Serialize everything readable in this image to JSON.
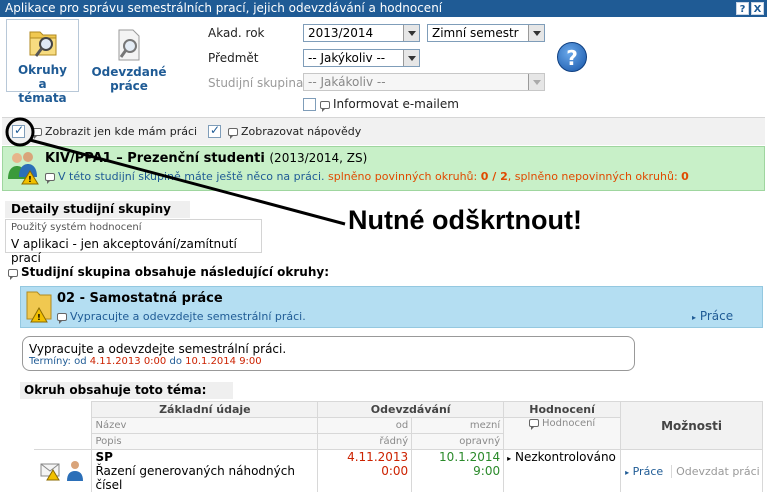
{
  "window": {
    "title": "Aplikace pro správu semestrálních prací, jejich odevzdávání a hodnocení",
    "help_button": "?",
    "close_button": "X"
  },
  "nav": {
    "topics": "Okruhy a témata",
    "submitted": "Odevzdané práce"
  },
  "filters": {
    "year_label": "Akad. rok",
    "year_value": "2013/2014",
    "semester_value": "Zimní semestr",
    "subject_label": "Předmět",
    "subject_value": "-- Jakýkoliv --",
    "group_label": "Studijní skupina",
    "group_value": "-- Jakákoliv --",
    "notify_label": "Informovat e-mailem",
    "show_only_mine_label": "Zobrazit jen kde mám práci",
    "show_hints_label": "Zobrazovat nápovědy",
    "help_icon": "?"
  },
  "group": {
    "title": "KIV/PPA1 – Prezenční studenti",
    "period": "(2013/2014, ZS)",
    "info_prefix": "V této studijní skupině máte ještě něco na práci.",
    "mandatory_text": "splněno povinných okruhů:",
    "mandatory_value": "0 / 2",
    "optional_text": "splněno nepovinných okruhů:",
    "optional_value": "0"
  },
  "details": {
    "title": "Detaily studijní skupiny",
    "system_label": "Použitý systém hodnocení",
    "system_value": "V aplikaci - jen akceptování/zamítnutí prací"
  },
  "annotation": "Nutné odškrtnout!",
  "section_title": "Studijní skupina obsahuje následující okruhy:",
  "okruh": {
    "title": "02 - Samostatná práce",
    "subtitle": "Vypracujte a odevzdejte semestrální práci.",
    "link": "Práce",
    "desc": "Vypracujte a odevzdejte semestrální práci.",
    "terms_prefix": "Termíny: od",
    "terms_from": "4.11.2013 0:00",
    "terms_mid": "do",
    "terms_to": "10.1.2014 9:00"
  },
  "topic": {
    "title": "Okruh obsahuje toto téma:",
    "headers": {
      "basic": "Základní údaje",
      "submission": "Odevzdávání",
      "evaluation": "Hodnocení",
      "options": "Možnosti",
      "name": "Název",
      "description": "Popis",
      "from": "od",
      "deadline": "mezní",
      "regular": "řádný",
      "corrective": "opravný",
      "evaluation_sub": "Hodnocení"
    },
    "row": {
      "name": "SP",
      "description": "Řazení generovaných náhodných čísel",
      "date_regular": "4.11.2013 0:00",
      "date_corrective": "10.1.2014 9:00",
      "status": "Nezkontrolováno",
      "link_work": "Práce",
      "link_submit": "Odevzdat práci"
    }
  }
}
